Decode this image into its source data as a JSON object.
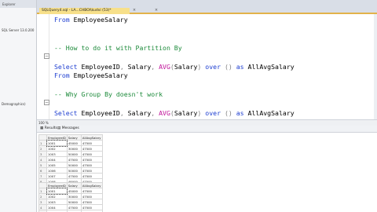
{
  "explorer": {
    "header": "Explorer",
    "items": [
      "SQL Server 13.0.200",
      "Demographics)"
    ]
  },
  "tab": {
    "title": "SQLQuery4.sql - LA...CHBOl\\kudvi (53)*",
    "pin": "×",
    "close": "×"
  },
  "editor": {
    "lines": [
      {
        "parts": [
          {
            "t": "From ",
            "c": "kw"
          },
          {
            "t": "EmployeeSalary",
            "c": ""
          }
        ]
      },
      {
        "parts": []
      },
      {
        "parts": []
      },
      {
        "parts": [
          {
            "t": "-- How to do it with Partition By",
            "c": "cm"
          }
        ]
      },
      {
        "parts": []
      },
      {
        "parts": [
          {
            "t": "Select ",
            "c": "kw"
          },
          {
            "t": "EmployeeID",
            "c": ""
          },
          {
            "t": ", ",
            "c": "gray"
          },
          {
            "t": "Salary",
            "c": ""
          },
          {
            "t": ", ",
            "c": "gray"
          },
          {
            "t": "AVG",
            "c": "fn"
          },
          {
            "t": "(",
            "c": "gray"
          },
          {
            "t": "Salary",
            "c": ""
          },
          {
            "t": ") ",
            "c": "gray"
          },
          {
            "t": "over ",
            "c": "kw"
          },
          {
            "t": "() ",
            "c": "gray"
          },
          {
            "t": "as ",
            "c": "kw"
          },
          {
            "t": "AllAvgSalary",
            "c": ""
          }
        ]
      },
      {
        "parts": [
          {
            "t": "From ",
            "c": "kw"
          },
          {
            "t": "EmployeeSalary",
            "c": ""
          }
        ]
      },
      {
        "parts": []
      },
      {
        "parts": [
          {
            "t": "-- Why Group By doesn't work",
            "c": "cm"
          }
        ]
      },
      {
        "parts": []
      },
      {
        "parts": [
          {
            "t": "Select ",
            "c": "kw"
          },
          {
            "t": "EmployeeID",
            "c": ""
          },
          {
            "t": ", ",
            "c": "gray"
          },
          {
            "t": "Salary",
            "c": ""
          },
          {
            "t": ", ",
            "c": "gray"
          },
          {
            "t": "AVG",
            "c": "fn"
          },
          {
            "t": "(",
            "c": "gray"
          },
          {
            "t": "Salary",
            "c": ""
          },
          {
            "t": ") ",
            "c": "gray"
          },
          {
            "t": "over ",
            "c": "kw"
          },
          {
            "t": "() ",
            "c": "gray"
          },
          {
            "t": "as ",
            "c": "kw"
          },
          {
            "t": "AllAvgSalary",
            "c": ""
          }
        ]
      },
      {
        "parts": [
          {
            "t": "From ",
            "c": "kw"
          },
          {
            "t": "EmployeeSalary",
            "c": ""
          }
        ]
      }
    ]
  },
  "zoom": "100 %",
  "results": {
    "tabs": [
      {
        "label": "Results",
        "icon": "grid-icon"
      },
      {
        "label": "Messages",
        "icon": "message-icon"
      }
    ],
    "grid1": {
      "columns": [
        "EmployeeID",
        "Salary",
        "AllAvgSalary"
      ],
      "rows": [
        [
          "1",
          "1001",
          "45000",
          "47500"
        ],
        [
          "2",
          "1002",
          "30000",
          "47500"
        ],
        [
          "3",
          "1003",
          "50000",
          "47500"
        ],
        [
          "4",
          "1004",
          "47500",
          "47500"
        ],
        [
          "5",
          "1005",
          "50000",
          "47500"
        ],
        [
          "6",
          "1006",
          "50000",
          "47500"
        ],
        [
          "7",
          "1007",
          "47500",
          "47500"
        ],
        [
          "8",
          "1008",
          "48000",
          "47500"
        ]
      ]
    },
    "grid2": {
      "columns": [
        "EmployeeID",
        "Salary",
        "AllAvgSalary"
      ],
      "rows": [
        [
          "1",
          "1001",
          "45000",
          "47500"
        ],
        [
          "2",
          "1002",
          "30000",
          "47500"
        ],
        [
          "3",
          "1003",
          "50000",
          "47500"
        ],
        [
          "4",
          "1004",
          "47500",
          "47500"
        ],
        [
          "5",
          "1005",
          "50000",
          "47500"
        ]
      ]
    }
  }
}
